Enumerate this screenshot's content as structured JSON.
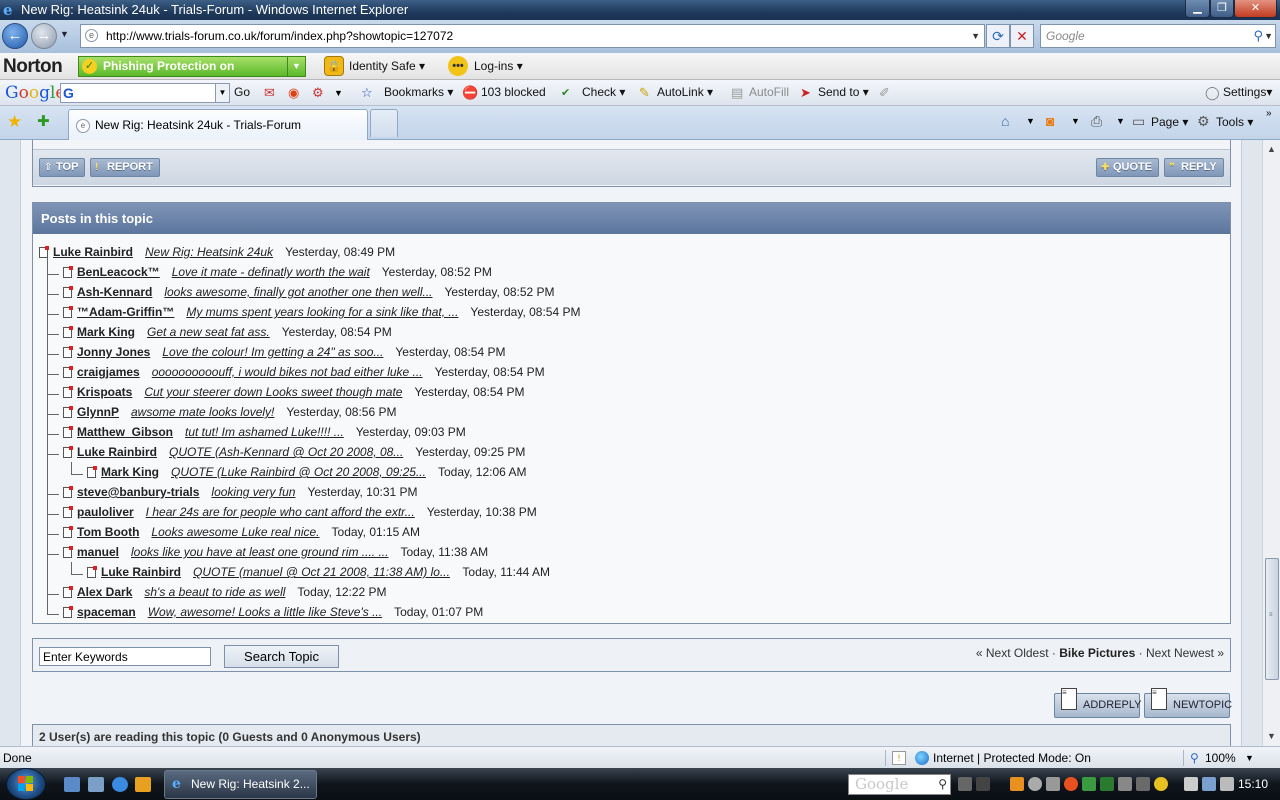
{
  "window": {
    "title": "New Rig: Heatsink 24uk - Trials-Forum - Windows Internet Explorer"
  },
  "address": {
    "url": "http://www.trials-forum.co.uk/forum/index.php?showtopic=127072",
    "search_placeholder": "Google"
  },
  "norton": {
    "logo": "Norton",
    "phishing": "Phishing Protection on",
    "identity_safe": "Identity Safe",
    "logins": "Log-ins"
  },
  "googlebar": {
    "go": "Go",
    "bookmarks": "Bookmarks",
    "blocked": "103 blocked",
    "check": "Check",
    "autolink": "AutoLink",
    "autofill": "AutoFill",
    "sendto": "Send to",
    "settings": "Settings"
  },
  "tabs": {
    "active_title": "New Rig: Heatsink 24uk - Trials-Forum",
    "page": "Page",
    "tools": "Tools"
  },
  "post_footer": {
    "top": "TOP",
    "report": "REPORT",
    "quote": "QUOTE",
    "reply": "REPLY"
  },
  "topic": {
    "header": "Posts in this topic",
    "posts": [
      {
        "author": "Luke Rainbird",
        "excerpt": "New Rig: Heatsink 24uk",
        "time": "Yesterday, 08:49 PM",
        "depth": 0
      },
      {
        "author": "BenLeacock™",
        "excerpt": "Love it mate - definatly worth the wait",
        "time": "Yesterday, 08:52 PM",
        "depth": 1
      },
      {
        "author": "Ash-Kennard",
        "excerpt": "looks awesome, finally got another one then well...",
        "time": "Yesterday, 08:52 PM",
        "depth": 1
      },
      {
        "author": "™Adam-Griffin™",
        "excerpt": "My mums spent years looking for a sink like that, ...",
        "time": "Yesterday, 08:54 PM",
        "depth": 1
      },
      {
        "author": "Mark King",
        "excerpt": "Get a new seat fat ass.",
        "time": "Yesterday, 08:54 PM",
        "depth": 1
      },
      {
        "author": "Jonny Jones",
        "excerpt": "Love the colour! Im getting a 24\" as soo...",
        "time": "Yesterday, 08:54 PM",
        "depth": 1
      },
      {
        "author": "craigjames",
        "excerpt": "oooooooooouff, i would bikes not bad either luke ...",
        "time": "Yesterday, 08:54 PM",
        "depth": 1
      },
      {
        "author": "Krispoats",
        "excerpt": "Cut your steerer down Looks sweet though mate",
        "time": "Yesterday, 08:54 PM",
        "depth": 1
      },
      {
        "author": "GlynnP",
        "excerpt": "awsome mate looks lovely!",
        "time": "Yesterday, 08:56 PM",
        "depth": 1
      },
      {
        "author": "Matthew_Gibson",
        "excerpt": "tut tut! Im ashamed Luke!!!! ...",
        "time": "Yesterday, 09:03 PM",
        "depth": 1
      },
      {
        "author": "Luke Rainbird",
        "excerpt": "QUOTE (Ash-Kennard @ Oct 20 2008, 08...",
        "time": "Yesterday, 09:25 PM",
        "depth": 1
      },
      {
        "author": "Mark King",
        "excerpt": "QUOTE (Luke Rainbird @ Oct 20 2008, 09:25...",
        "time": "Today, 12:06 AM",
        "depth": 2
      },
      {
        "author": "steve@banbury-trials",
        "excerpt": "looking very fun",
        "time": "Yesterday, 10:31 PM",
        "depth": 1
      },
      {
        "author": "pauloliver",
        "excerpt": "I hear 24s are for people who cant afford the extr...",
        "time": "Yesterday, 10:38 PM",
        "depth": 1
      },
      {
        "author": "Tom Booth",
        "excerpt": "Looks awesome Luke real nice.",
        "time": "Today, 01:15 AM",
        "depth": 1
      },
      {
        "author": "manuel",
        "excerpt": "looks like you have at least one ground rim .... ...",
        "time": "Today, 11:38 AM",
        "depth": 1
      },
      {
        "author": "Luke Rainbird",
        "excerpt": "QUOTE (manuel @ Oct 21 2008, 11:38 AM) lo...",
        "time": "Today, 11:44 AM",
        "depth": 2
      },
      {
        "author": "Alex Dark",
        "excerpt": "sh's a beaut to ride as well",
        "time": "Today, 12:22 PM",
        "depth": 1
      },
      {
        "author": "spaceman",
        "excerpt": "Wow, awesome! Looks a little like Steve's ...",
        "time": "Today, 01:07 PM",
        "depth": 1
      }
    ]
  },
  "search": {
    "keywords_value": "Enter Keywords",
    "button": "Search Topic",
    "prev": "« Next Oldest",
    "sep": "·",
    "current": "Bike Pictures",
    "next": "Next Newest »"
  },
  "actions": {
    "add_reply": "ADDREPLY",
    "new_topic": "NEWTOPIC"
  },
  "readers": "2 User(s) are reading this topic (0 Guests and 0 Anonymous Users)",
  "status": {
    "left": "Done",
    "zone": "Internet | Protected Mode: On",
    "zoom": "100%"
  },
  "taskbar": {
    "task": "New Rig: Heatsink 2...",
    "search_logo": "Google",
    "clock": "15:10"
  }
}
